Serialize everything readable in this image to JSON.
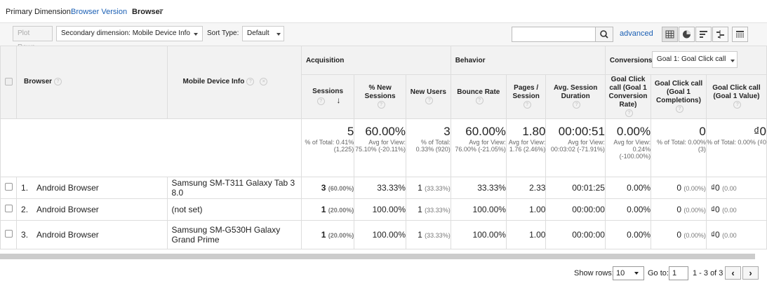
{
  "top": {
    "primary_label": "Primary Dimension:",
    "dim_link": "Browser Version",
    "dim_current": "Browser"
  },
  "toolbar": {
    "plot_rows": "Plot Rows",
    "secondary_dimension": "Secondary dimension: Mobile Device Info",
    "sort_type_label": "Sort Type:",
    "sort_type_value": "Default",
    "advanced": "advanced"
  },
  "table": {
    "groups": {
      "acquisition": "Acquisition",
      "behavior": "Behavior",
      "conversions": "Conversions",
      "goal_select": "Goal 1: Goal Click call"
    },
    "headers": {
      "browser": "Browser",
      "mobile_device_info": "Mobile Device Info",
      "sessions": "Sessions",
      "new_sessions": "% New Sessions",
      "new_users": "New Users",
      "bounce_rate": "Bounce Rate",
      "pages_session": "Pages / Session",
      "avg_session_duration": "Avg. Session Duration",
      "goal_conv_rate": "Goal Click call (Goal 1 Conversion Rate)",
      "goal_completions": "Goal Click call (Goal 1 Completions)",
      "goal_value": "Goal Click call (Goal 1 Value)"
    },
    "totals": {
      "sessions": {
        "value": "5",
        "sub": "% of Total: 0.41% (1,225)"
      },
      "new_sessions": {
        "value": "60.00%",
        "sub": "Avg for View: 75.10% (-20.11%)"
      },
      "new_users": {
        "value": "3",
        "sub": "% of Total: 0.33% (920)"
      },
      "bounce_rate": {
        "value": "60.00%",
        "sub": "Avg for View: 76.00% (-21.05%)"
      },
      "pages_session": {
        "value": "1.80",
        "sub": "Avg for View: 1.76 (2.46%)"
      },
      "avg_session_duration": {
        "value": "00:00:51",
        "sub": "Avg for View: 00:03:02 (-71.91%)"
      },
      "goal_conv_rate": {
        "value": "0.00%",
        "sub": "Avg for View: 0.24% (-100.00%)"
      },
      "goal_completions": {
        "value": "0",
        "sub": "% of Total: 0.00% (3)"
      },
      "goal_value": {
        "value": "₫0",
        "sub": "% of Total: 0.00% (₫0"
      }
    },
    "rows": [
      {
        "idx": "1.",
        "browser": "Android Browser",
        "device": "Samsung SM-T311 Galaxy Tab 3 8.0",
        "sessions": "3",
        "sessions_pct": "(60.00%)",
        "new_sessions": "33.33%",
        "new_users": "1",
        "new_users_pct": "(33.33%)",
        "bounce_rate": "33.33%",
        "pages_session": "2.33",
        "avg_session_duration": "00:01:25",
        "goal_conv_rate": "0.00%",
        "goal_completions": "0",
        "goal_completions_pct": "(0.00%)",
        "goal_value": "₫0",
        "goal_value_pct": "(0.00"
      },
      {
        "idx": "2.",
        "browser": "Android Browser",
        "device": "(not set)",
        "sessions": "1",
        "sessions_pct": "(20.00%)",
        "new_sessions": "100.00%",
        "new_users": "1",
        "new_users_pct": "(33.33%)",
        "bounce_rate": "100.00%",
        "pages_session": "1.00",
        "avg_session_duration": "00:00:00",
        "goal_conv_rate": "0.00%",
        "goal_completions": "0",
        "goal_completions_pct": "(0.00%)",
        "goal_value": "₫0",
        "goal_value_pct": "(0.00"
      },
      {
        "idx": "3.",
        "browser": "Android Browser",
        "device": "Samsung SM-G530H Galaxy Grand Prime",
        "sessions": "1",
        "sessions_pct": "(20.00%)",
        "new_sessions": "100.00%",
        "new_users": "1",
        "new_users_pct": "(33.33%)",
        "bounce_rate": "100.00%",
        "pages_session": "1.00",
        "avg_session_duration": "00:00:00",
        "goal_conv_rate": "0.00%",
        "goal_completions": "0",
        "goal_completions_pct": "(0.00%)",
        "goal_value": "₫0",
        "goal_value_pct": "(0.00"
      }
    ]
  },
  "footer": {
    "show_rows_label": "Show rows:",
    "show_rows_value": "10",
    "goto_label": "Go to:",
    "goto_value": "1",
    "range": "1 - 3 of 3"
  },
  "colors": {
    "link": "#1a5fb4",
    "header_bg": "#f2f2f2"
  }
}
